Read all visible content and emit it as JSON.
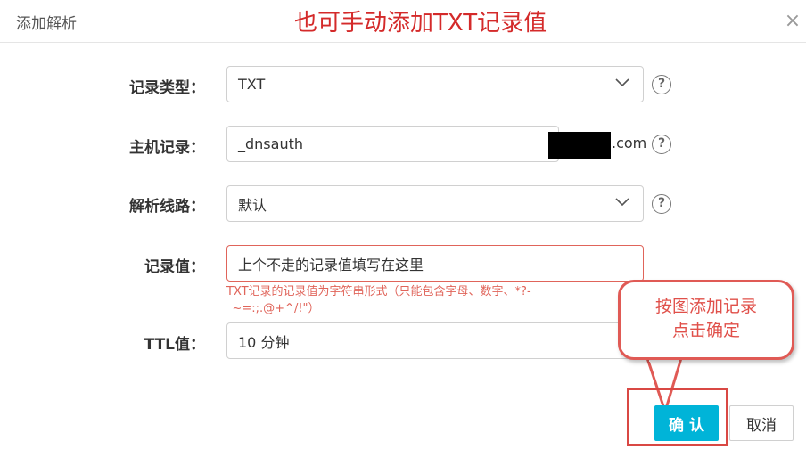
{
  "dialog": {
    "title": "添加解析",
    "annotation_title": "也可手动添加TXT记录值",
    "close_symbol": "×"
  },
  "form": {
    "record_type": {
      "label": "记录类型：",
      "value": "TXT"
    },
    "host": {
      "label": "主机记录：",
      "value": "_dnsauth",
      "suffix": ".com"
    },
    "line": {
      "label": "解析线路：",
      "value": "默认"
    },
    "record_value": {
      "label": "记录值：",
      "value": "上个不走的记录值填写在这里",
      "hint": "TXT记录的记录值为字符串形式（只能包含字母、数字、*?-_~=:;.@+^/!\"）"
    },
    "ttl": {
      "label": "TTL值：",
      "value": "10 分钟"
    },
    "help_symbol": "?"
  },
  "callout": {
    "line1": "按图添加记录",
    "line2": "点击确定"
  },
  "buttons": {
    "confirm": "确 认",
    "cancel": "取消"
  },
  "colors": {
    "accent": "#00b4d8",
    "annotation": "#d42a2a",
    "error": "#e0645a"
  }
}
